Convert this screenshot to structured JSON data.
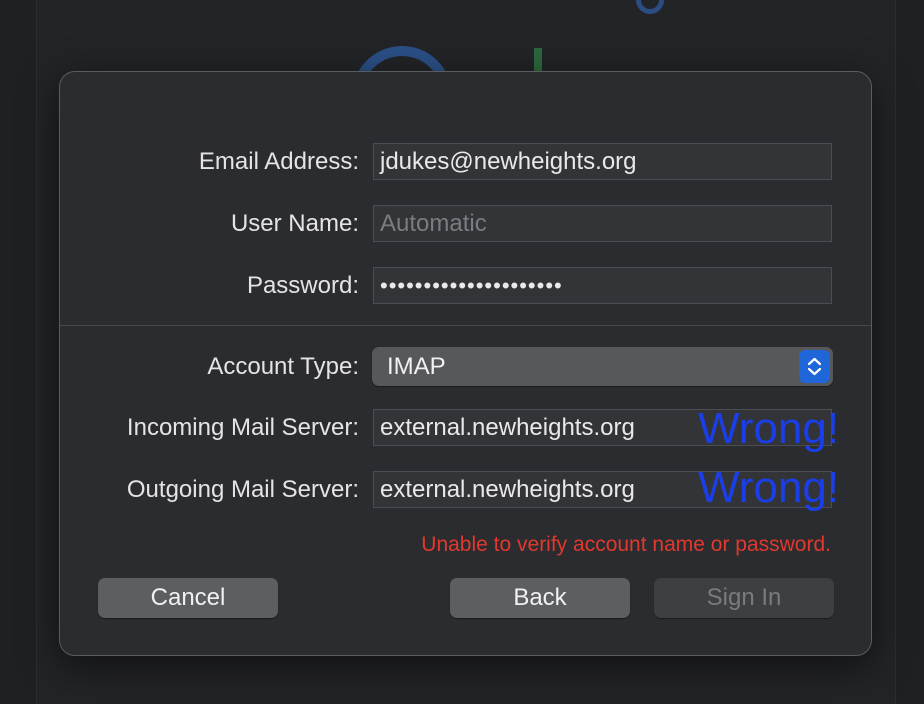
{
  "form": {
    "email_label": "Email Address:",
    "email_value": "jdukes@newheights.org",
    "username_label": "User Name:",
    "username_placeholder": "Automatic",
    "password_label": "Password:",
    "password_value": "•••••••••••••••••••••",
    "account_type_label": "Account Type:",
    "account_type_value": "IMAP",
    "incoming_label": "Incoming Mail Server:",
    "incoming_value": "external.newheights.org",
    "outgoing_label": "Outgoing Mail Server:",
    "outgoing_value": "external.newheights.org"
  },
  "annotations": {
    "incoming_note": "Wrong!",
    "outgoing_note": "Wrong!"
  },
  "error_message": "Unable to verify account name or password.",
  "buttons": {
    "cancel": "Cancel",
    "back": "Back",
    "sign_in": "Sign In"
  },
  "colors": {
    "error": "#e2382d",
    "annotation": "#1a3fe8",
    "accent": "#1f66d9"
  },
  "icons": {
    "popup": "chevron-up-down-icon"
  }
}
